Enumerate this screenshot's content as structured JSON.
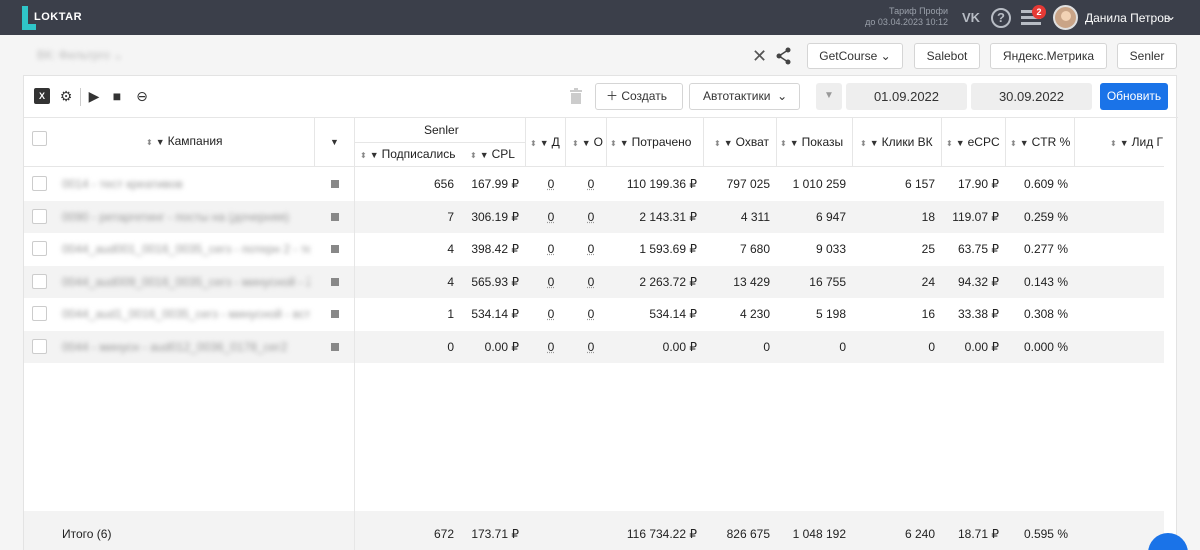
{
  "topbar": {
    "logo_text": "LOKTAR",
    "tariff_line1": "Тариф Профи",
    "tariff_line2": "до 03.04.2023 10:12",
    "vk_icon": "vk-icon",
    "notifications_count": "2",
    "user_name": "Данила Петров"
  },
  "subbar": {
    "project_select": "ВК: Фильтрго",
    "buttons": [
      "GetCourse",
      "Salebot",
      "Яндекс.Метрика",
      "Senler"
    ]
  },
  "toolbar": {
    "create_label": "Создать",
    "autotactics_label": "Автотактики",
    "date_from": "01.09.2022",
    "date_to": "30.09.2022",
    "refresh_label": "Обновить"
  },
  "table": {
    "group_header": "Senler",
    "headers": {
      "campaign": "Кампания",
      "subscribed": "Подписались",
      "cpl": "CPL",
      "d": "Д",
      "o": "О",
      "spent": "Потрачено",
      "reach": "Охват",
      "shows": "Показы",
      "clicks": "Клики ВК",
      "ecpc": "eCPC",
      "ctr": "CTR %",
      "lead": "Лид Г"
    },
    "rows": [
      {
        "name": "0014 - тест креативов",
        "subscribed": "656",
        "cpl": "167.99 ₽",
        "d": "0",
        "o": "0",
        "spent": "110 199.36 ₽",
        "reach": "797 025",
        "shows": "1 010 259",
        "clicks": "6 157",
        "ecpc": "17.90 ₽",
        "ctr": "0.609 %"
      },
      {
        "name": "0090 - ретаргетинг - посты на (дочерняя)",
        "subscribed": "7",
        "cpl": "306.19 ₽",
        "d": "0",
        "o": "0",
        "spent": "2 143.31 ₽",
        "reach": "4 311",
        "shows": "6 947",
        "clicks": "18",
        "ecpc": "119.07 ₽",
        "ctr": "0.259 %"
      },
      {
        "name": "0044_aud001_0016_0035_сегз - потерн 2 - тел",
        "subscribed": "4",
        "cpl": "398.42 ₽",
        "d": "0",
        "o": "0",
        "spent": "1 593.69 ₽",
        "reach": "7 680",
        "shows": "9 033",
        "clicks": "25",
        "ecpc": "63.75 ₽",
        "ctr": "0.277 %"
      },
      {
        "name": "0044_aud009_0016_0035_сегз - минусной - 2",
        "subscribed": "4",
        "cpl": "565.93 ₽",
        "d": "0",
        "o": "0",
        "spent": "2 263.72 ₽",
        "reach": "13 429",
        "shows": "16 755",
        "clicks": "24",
        "ecpc": "94.32 ₽",
        "ctr": "0.143 %"
      },
      {
        "name": "0044_aud1_0016_0035_сегз - минусной - вст",
        "subscribed": "1",
        "cpl": "534.14 ₽",
        "d": "0",
        "o": "0",
        "spent": "534.14 ₽",
        "reach": "4 230",
        "shows": "5 198",
        "clicks": "16",
        "ecpc": "33.38 ₽",
        "ctr": "0.308 %"
      },
      {
        "name": "0044 - минусн - aud012_0036_0178_сег2",
        "subscribed": "0",
        "cpl": "0.00 ₽",
        "d": "0",
        "o": "0",
        "spent": "0.00 ₽",
        "reach": "0",
        "shows": "0",
        "clicks": "0",
        "ecpc": "0.00 ₽",
        "ctr": "0.000 %"
      }
    ],
    "total": {
      "label": "Итого (6)",
      "subscribed": "672",
      "cpl": "173.71 ₽",
      "spent": "116 734.22 ₽",
      "reach": "826 675",
      "shows": "1 048 192",
      "clicks": "6 240",
      "ecpc": "18.71 ₽",
      "ctr": "0.595 %"
    }
  }
}
